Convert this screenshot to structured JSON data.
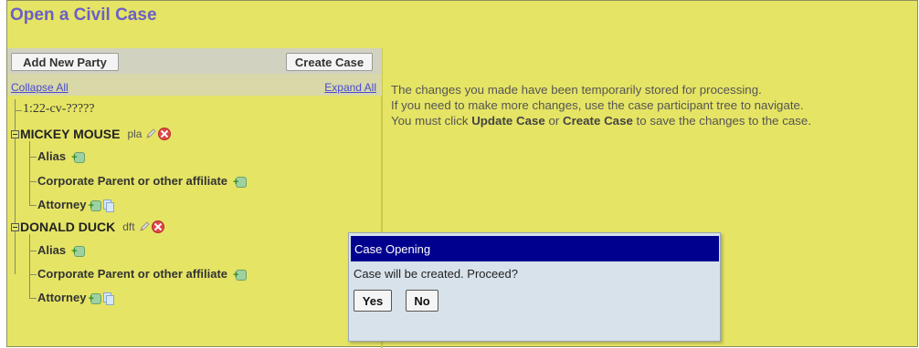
{
  "page": {
    "title": "Open a Civil Case"
  },
  "toolbar": {
    "add_party_label": "Add New Party",
    "create_case_label": "Create Case"
  },
  "tree_links": {
    "collapse_all": "Collapse All",
    "expand_all": "Expand All"
  },
  "tree": {
    "case_number": "1:22-cv-?????",
    "parties": [
      {
        "name": "MICKEY MOUSE",
        "role": "pla",
        "children": [
          "Alias",
          "Corporate Parent or other affiliate",
          "Attorney"
        ]
      },
      {
        "name": "DONALD DUCK",
        "role": "dft",
        "children": [
          "Alias",
          "Corporate Parent or other affiliate",
          "Attorney"
        ]
      }
    ]
  },
  "info": {
    "line1": "The changes you made have been temporarily stored for processing.",
    "line2": "If you need to make more changes, use the case participant tree to navigate.",
    "line3_pre": "You must click ",
    "line3_update": "Update Case",
    "line3_mid": " or ",
    "line3_create": "Create Case",
    "line3_post": " to save the changes to the case."
  },
  "dialog": {
    "title": "Case Opening",
    "message": "Case will be created. Proceed?",
    "yes_label": "Yes",
    "no_label": "No"
  },
  "colors": {
    "background": "#e5e465",
    "title": "#6b5fc6",
    "dialog_title_bar": "#00008e",
    "dialog_body": "#d8e2ea"
  },
  "icons": {
    "edit": "pencil-icon",
    "delete": "delete-icon",
    "add": "add-person-icon",
    "copy": "copy-icon",
    "expander": "collapse-toggle-icon"
  }
}
